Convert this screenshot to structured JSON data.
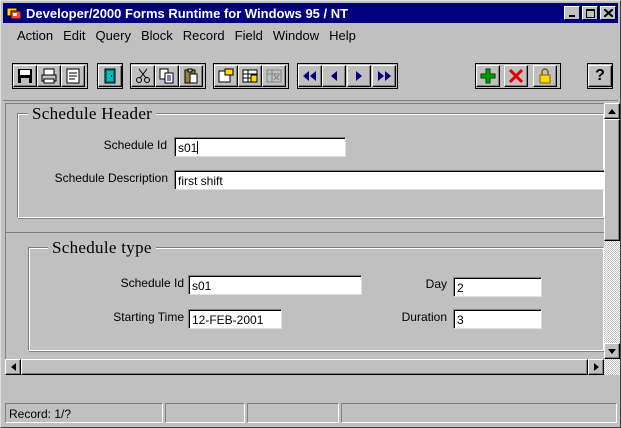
{
  "window": {
    "title": "Developer/2000 Forms Runtime for Windows 95 / NT"
  },
  "menu": [
    "Action",
    "Edit",
    "Query",
    "Block",
    "Record",
    "Field",
    "Window",
    "Help"
  ],
  "toolbar": {
    "help_label": "?"
  },
  "schedule_header": {
    "title": "Schedule Header",
    "schedule_id_label": "Schedule Id",
    "schedule_id_value": "s01",
    "description_label": "Schedule Description",
    "description_value": "first shift"
  },
  "schedule_type": {
    "title": "Schedule type",
    "schedule_id_label": "Schedule Id",
    "schedule_id_value": "s01",
    "day_label": "Day",
    "day_value": "2",
    "starting_time_label": "Starting Time",
    "starting_time_value": "12-FEB-2001",
    "duration_label": "Duration",
    "duration_value": "3"
  },
  "status": {
    "record": "Record: 1/?"
  },
  "colors": {
    "titlebar": "#000080",
    "face": "#c0c0c0"
  }
}
